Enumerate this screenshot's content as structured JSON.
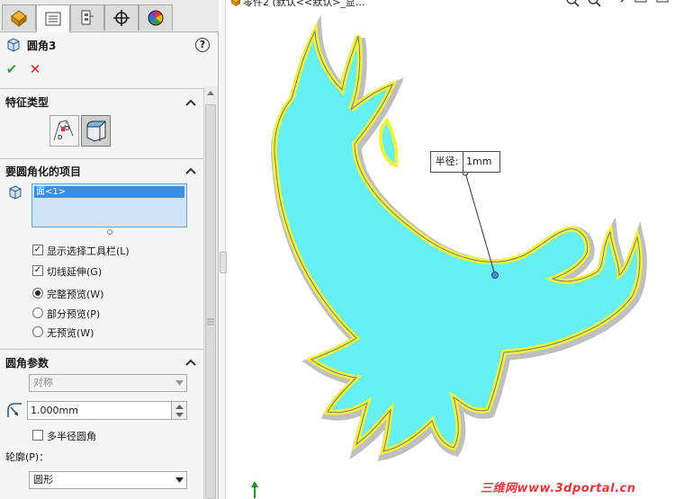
{
  "feature": {
    "title": "圆角3",
    "help": "?",
    "ok": "✔",
    "cancel": "✕"
  },
  "tabs": [
    "feature-manager",
    "property-manager",
    "configuration-manager",
    "dimxpert-manager",
    "display-manager"
  ],
  "feature_type": {
    "heading": "特征类型",
    "options": [
      "constant-size-fillet",
      "face-fillet"
    ],
    "selected": 1
  },
  "items_to_fillet": {
    "heading": "要圆角化的项目",
    "selected_item": "面<1>",
    "show_selection_toolbar": {
      "label": "显示选择工具栏(L)",
      "checked": true
    },
    "tangent_propagation": {
      "label": "切线延伸(G)",
      "checked": true
    },
    "preview": [
      {
        "label": "完整预览(W)",
        "selected": true
      },
      {
        "label": "部分预览(P)",
        "selected": false
      },
      {
        "label": "无预览(W)",
        "selected": false
      }
    ]
  },
  "fillet_params": {
    "heading": "圆角参数",
    "method": "对称",
    "radius": "1.000mm",
    "multiple_radius": {
      "label": "多半径圆角",
      "checked": false
    },
    "profile_label": "轮廓(P)：",
    "profile": "圆形"
  },
  "viewport": {
    "tree_header": "零件2 (默认<<默认>_显...",
    "callout_label": "半径:",
    "callout_value": "1mm",
    "watermark": "三维网www.3dportal.cn",
    "colors": {
      "fill": "#67f0f3",
      "edge": "#f2f23c",
      "outline": "#8a8a8a"
    }
  }
}
